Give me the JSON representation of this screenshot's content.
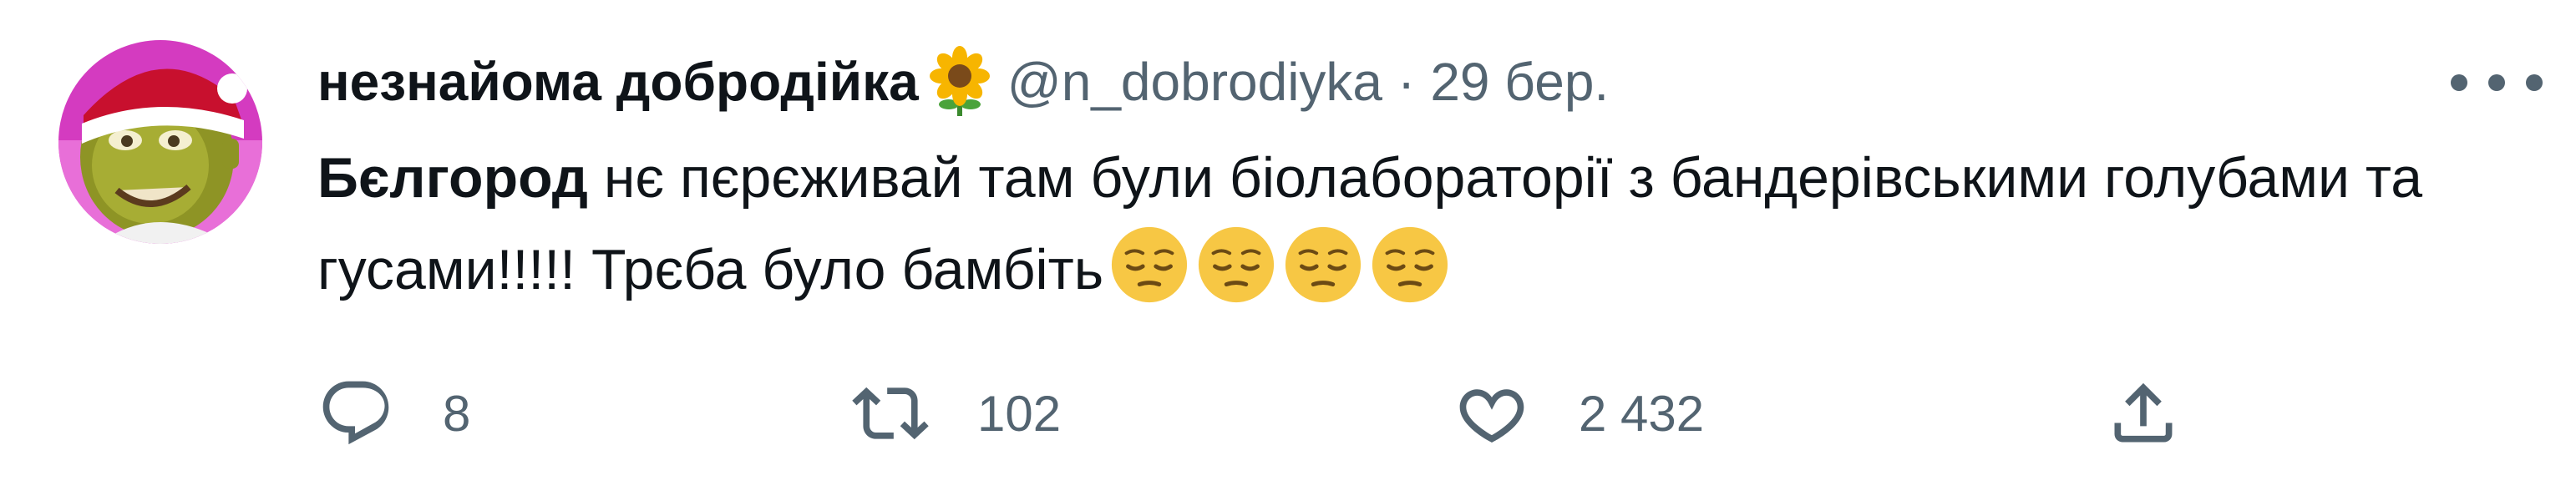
{
  "tweet": {
    "author": {
      "display_name": "незнайома добродійка",
      "handle": "@n_dobrodiyka"
    },
    "separator": "·",
    "date": "29 бер.",
    "body": {
      "mention": "Бєлгород",
      "text": " нє пєрєживай там були біолабораторії з бандерівськими голубами та гусами!!!!! Трєба було бамбіть",
      "emoji_count": 4,
      "emoji_icon": "pensive-face-icon"
    },
    "actions": {
      "reply_count": "8",
      "retweet_count": "102",
      "like_count": "2 432"
    },
    "icons": {
      "name_emoji": "sunflower-icon",
      "more": "more-horizontal-icon",
      "reply": "reply-icon",
      "retweet": "retweet-icon",
      "like": "heart-icon",
      "share": "share-icon"
    },
    "colors": {
      "text": "#0f1419",
      "secondary": "#536471",
      "emoji_yellow": "#f7c744"
    }
  }
}
